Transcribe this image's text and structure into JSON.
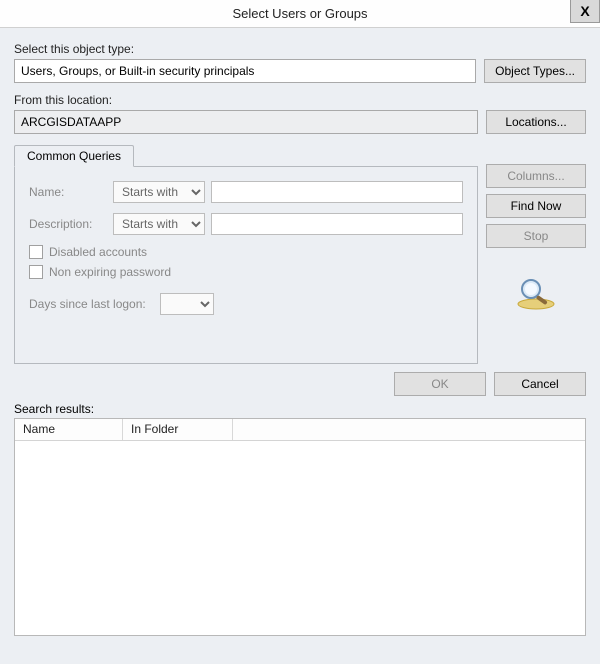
{
  "window": {
    "title": "Select Users or Groups",
    "close": "X"
  },
  "objectType": {
    "label": "Select this object type:",
    "value": "Users, Groups, or Built-in security principals",
    "button": "Object Types..."
  },
  "location": {
    "label": "From this location:",
    "value": "ARCGISDATAAPP",
    "button": "Locations..."
  },
  "queries": {
    "tab": "Common Queries",
    "nameLabel": "Name:",
    "nameMode": "Starts with",
    "nameValue": "",
    "descLabel": "Description:",
    "descMode": "Starts with",
    "descValue": "",
    "disabled": "Disabled accounts",
    "nonexp": "Non expiring password",
    "daysLabel": "Days since last logon:",
    "daysValue": ""
  },
  "sideButtons": {
    "columns": "Columns...",
    "findNow": "Find Now",
    "stop": "Stop"
  },
  "footer": {
    "ok": "OK",
    "cancel": "Cancel"
  },
  "results": {
    "label": "Search results:",
    "colName": "Name",
    "colFolder": "In Folder"
  }
}
